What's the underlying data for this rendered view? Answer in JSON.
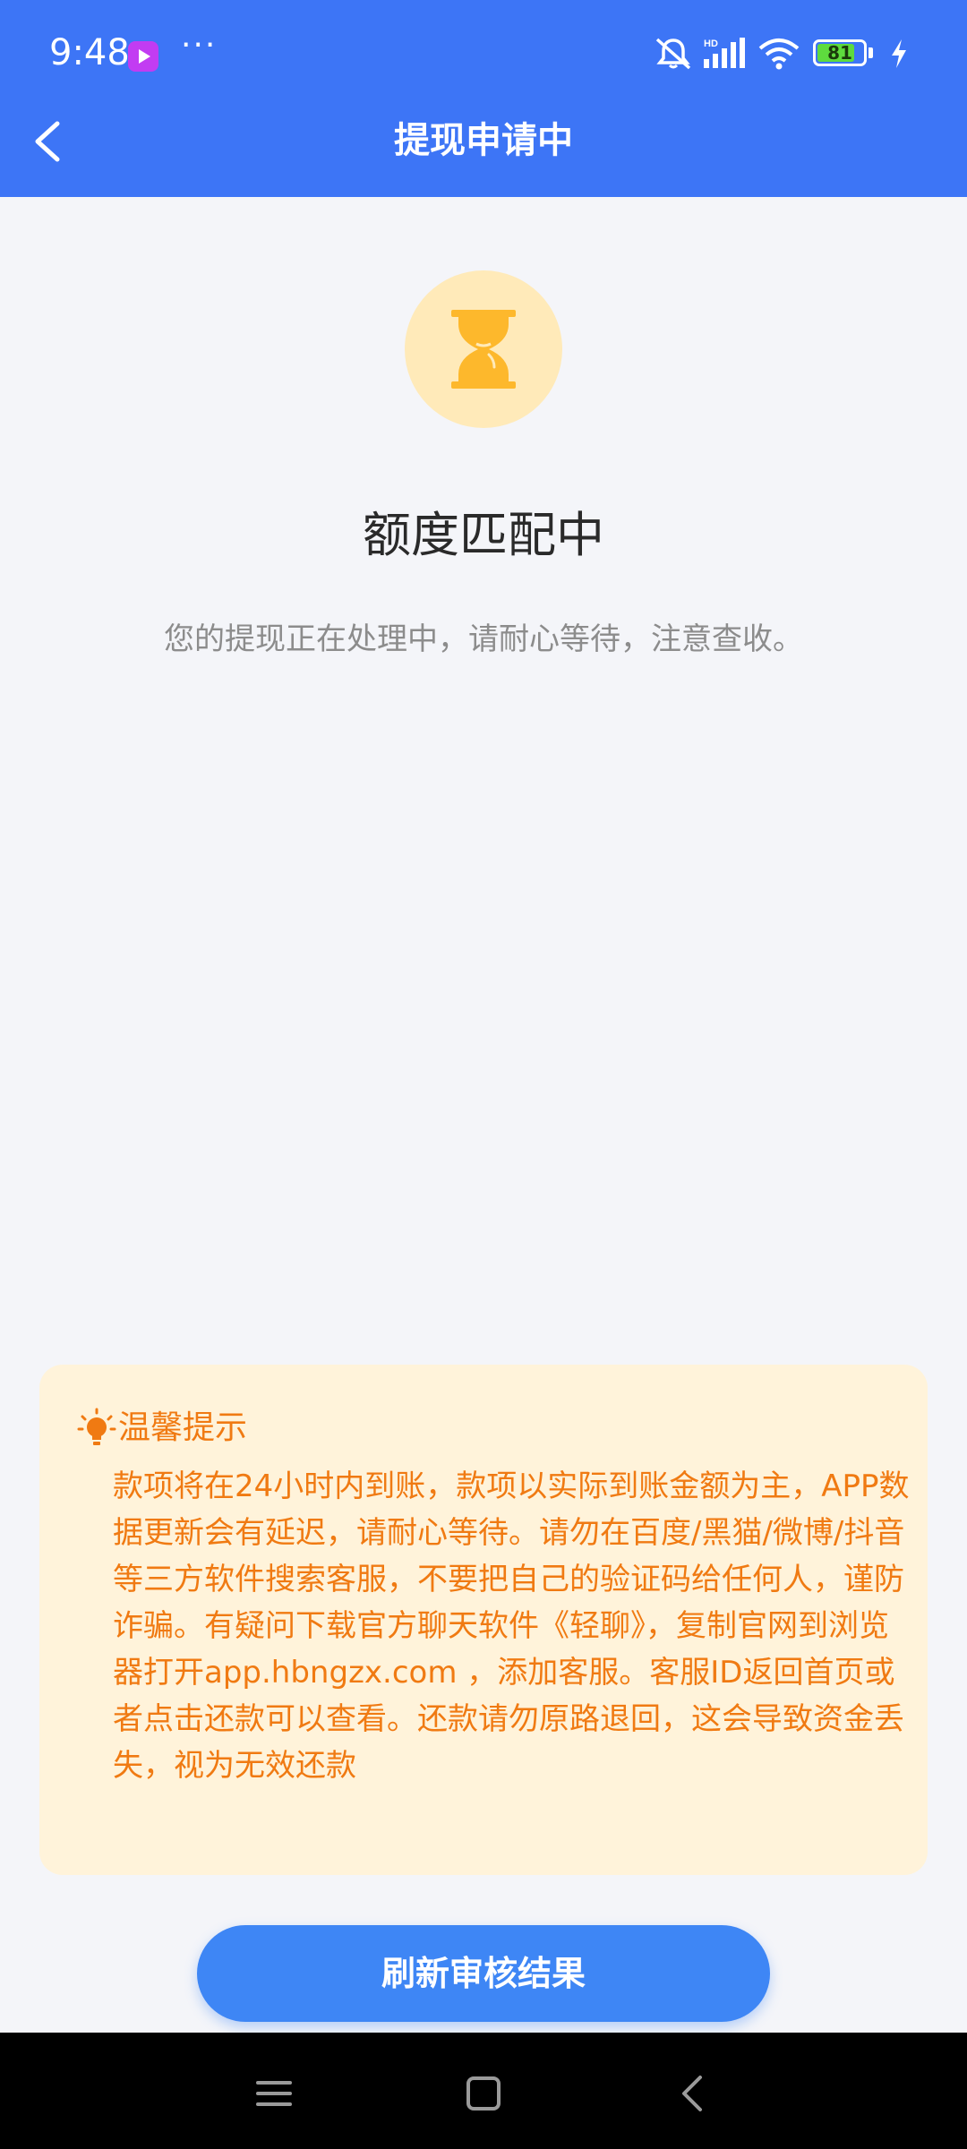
{
  "status_bar": {
    "time": "9:48",
    "dots": "···",
    "battery_level": "81",
    "battery_fraction": 0.81,
    "network_label": "HD"
  },
  "header": {
    "title": "提现申请中",
    "back_icon": "chevron-left-icon"
  },
  "status": {
    "icon": "hourglass-icon",
    "title": "额度匹配中",
    "description": "您的提现正在处理中，请耐心等待，注意查收。"
  },
  "tip": {
    "icon": "lightbulb-icon",
    "title": "温馨提示",
    "body": "款项将在24小时内到账，款项以实际到账金额为主，APP数据更新会有延迟，请耐心等待。请勿在百度/黑猫/微博/抖音等三方软件搜索客服，不要把自己的验证码给任何人，谨防诈骗。有疑问下载官方聊天软件《轻聊》，复制官网到浏览器打开app.hbngzx.com ，添加客服。客服ID返回首页或者点击还款可以查看。还款请勿原路退回，这会导致资金丢失，视为无效还款"
  },
  "actions": {
    "refresh_label": "刷新审核结果"
  },
  "system_nav": {
    "menu_icon": "menu-icon",
    "home_icon": "home-square-icon",
    "back_icon": "back-triangle-icon"
  },
  "colors": {
    "primary": "#3D75F6",
    "button": "#3E86F5",
    "tip_background": "#FFF3DA",
    "tip_text": "#F07A12",
    "hourglass": "#FDB82C",
    "hourglass_bg": "#FFEAB9"
  }
}
